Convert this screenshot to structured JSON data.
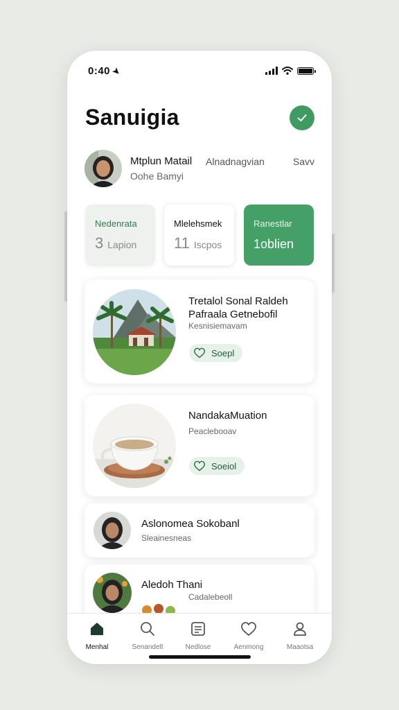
{
  "status": {
    "time": "0:40"
  },
  "header": {
    "title": "Sanuigia"
  },
  "profile": {
    "name": "Mtplun Matail",
    "sub": "Oohe Bamyi",
    "middle": "Alnadnagvian",
    "right": "Savv"
  },
  "stats": [
    {
      "label": "Nedenrata",
      "value": "3",
      "unit": "Lapion"
    },
    {
      "label": "Mlelehsmek",
      "value": "11",
      "unit": "Iscpos"
    },
    {
      "label": "Ranestlar",
      "value": "1oblien",
      "unit": ""
    }
  ],
  "cards": [
    {
      "title_line1": "Tretalol Sonal Raldeh",
      "title_line2": "Pafraala Getnebofil",
      "sub": "Kesnisiemavam",
      "tag": "Soepl"
    },
    {
      "title_line1": "NandakaMuation",
      "sub": "Peaclebooav",
      "tag": "Soeiol"
    },
    {
      "title_line1": "Aslonomea Sokobanl",
      "sub": "Sleainesneas"
    },
    {
      "title_line1": "Aledoh Thani",
      "sub": "Cadalebeoll"
    }
  ],
  "nav": [
    {
      "label": "Menhal",
      "icon": "home-icon"
    },
    {
      "label": "Senandelt",
      "icon": "search-icon"
    },
    {
      "label": "Nedlose",
      "icon": "list-icon"
    },
    {
      "label": "Aenmong",
      "icon": "heart-icon"
    },
    {
      "label": "Maaotsa",
      "icon": "profile-icon"
    }
  ],
  "colors": {
    "accent": "#44a066",
    "accent_dark": "#3f9b62",
    "background": "#e9ece6"
  }
}
